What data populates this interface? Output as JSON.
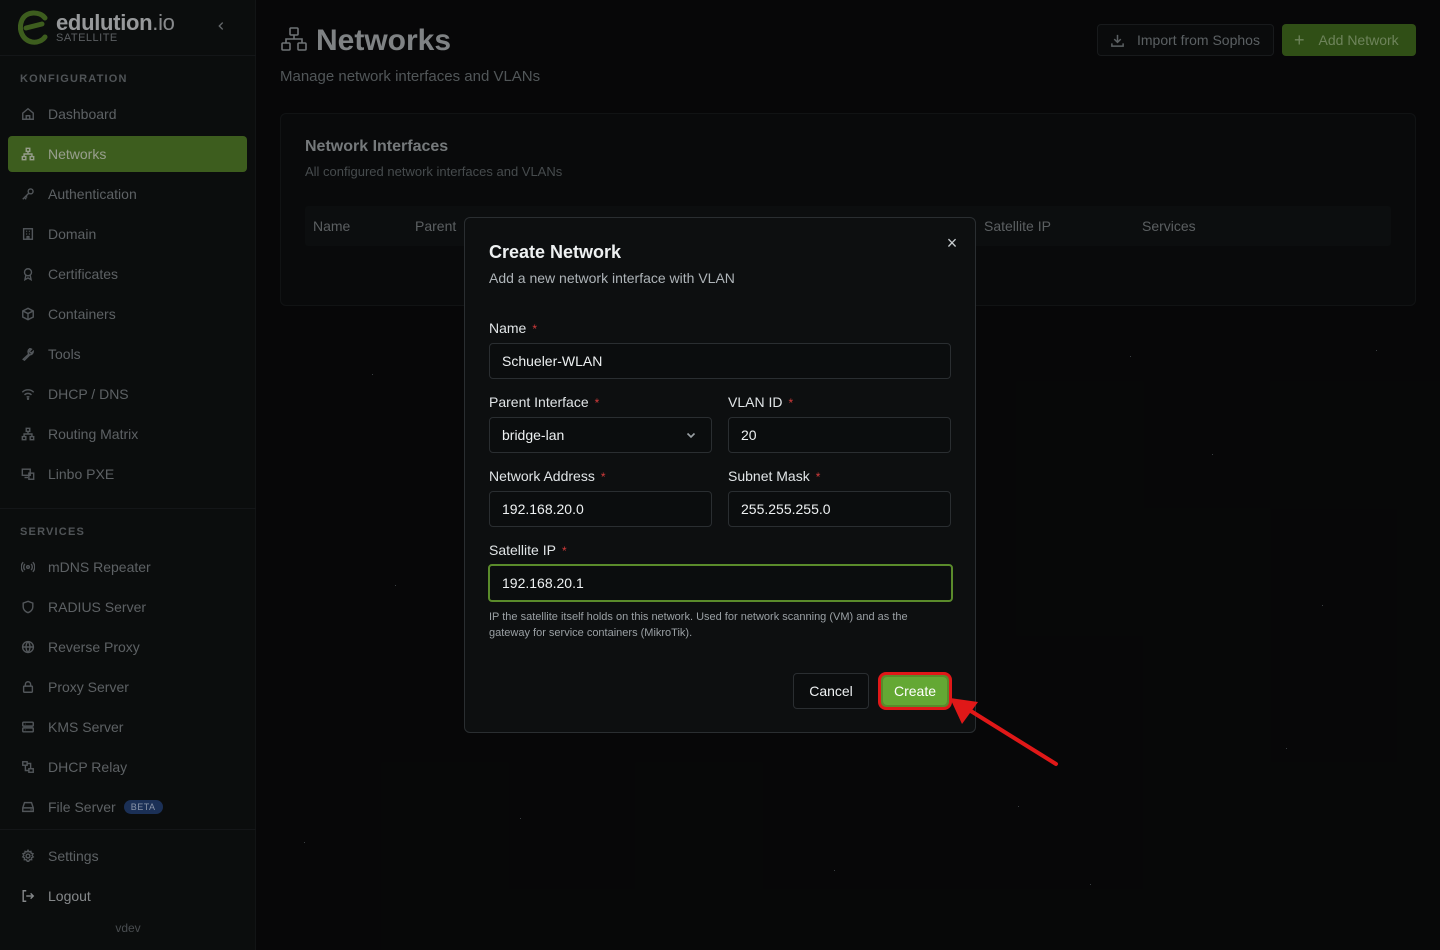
{
  "brand": {
    "name": "edulution",
    "name_suffix": ".io",
    "subtitle": "SATELLITE",
    "accent": "#5e8f2e"
  },
  "sidebar": {
    "section_config": "KONFIGURATION",
    "config_items": [
      {
        "label": "Dashboard",
        "icon": "home-icon"
      },
      {
        "label": "Networks",
        "icon": "network-icon",
        "active": true
      },
      {
        "label": "Authentication",
        "icon": "key-icon"
      },
      {
        "label": "Domain",
        "icon": "building-icon"
      },
      {
        "label": "Certificates",
        "icon": "award-icon"
      },
      {
        "label": "Containers",
        "icon": "box-icon"
      },
      {
        "label": "Tools",
        "icon": "wrench-icon"
      },
      {
        "label": "DHCP / DNS",
        "icon": "wifi-icon"
      },
      {
        "label": "Routing Matrix",
        "icon": "network-icon"
      },
      {
        "label": "Linbo PXE",
        "icon": "monitor-icon"
      }
    ],
    "section_services": "SERVICES",
    "service_items": [
      {
        "label": "mDNS Repeater",
        "icon": "radio-icon"
      },
      {
        "label": "RADIUS Server",
        "icon": "shield-icon"
      },
      {
        "label": "Reverse Proxy",
        "icon": "globe-icon"
      },
      {
        "label": "Proxy Server",
        "icon": "lock-icon"
      },
      {
        "label": "KMS Server",
        "icon": "server-icon"
      },
      {
        "label": "DHCP Relay",
        "icon": "relay-icon"
      },
      {
        "label": "File Server",
        "icon": "drive-icon",
        "badge": "BETA"
      }
    ],
    "settings_label": "Settings",
    "logout_label": "Logout",
    "version": "vdev"
  },
  "header": {
    "title": "Networks",
    "subtitle": "Manage network interfaces and VLANs",
    "import_label": "Import from Sophos",
    "add_label": "Add Network"
  },
  "card": {
    "title": "Network Interfaces",
    "subtitle": "All configured network interfaces and VLANs",
    "columns": [
      "Name",
      "Parent",
      "Satellite IP",
      "Services"
    ]
  },
  "modal": {
    "title": "Create Network",
    "subtitle": "Add a new network interface with VLAN",
    "fields": {
      "name": {
        "label": "Name",
        "value": "Schueler-WLAN"
      },
      "parent": {
        "label": "Parent Interface",
        "value": "bridge-lan"
      },
      "vlan": {
        "label": "VLAN ID",
        "value": "20"
      },
      "network": {
        "label": "Network Address",
        "value": "192.168.20.0"
      },
      "mask": {
        "label": "Subnet Mask",
        "value": "255.255.255.0"
      },
      "satellite": {
        "label": "Satellite IP",
        "value": "192.168.20.1"
      }
    },
    "required_mark": "*",
    "hint": "IP the satellite itself holds on this network. Used for network scanning (VM) and as the gateway for service containers (MikroTik).",
    "cancel_label": "Cancel",
    "create_label": "Create",
    "close_symbol": "×"
  }
}
